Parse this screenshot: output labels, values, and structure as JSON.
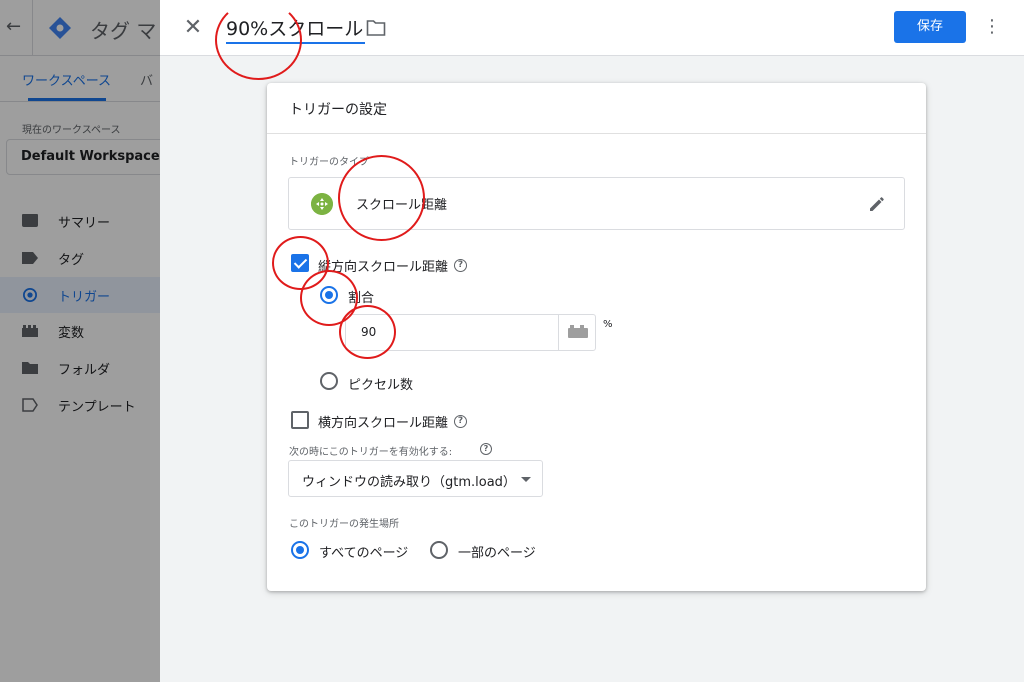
{
  "background": {
    "app_title": "タグ マ",
    "tabs": [
      "ワークスペース",
      "バ"
    ],
    "workspace_label": "現在のワークスペース",
    "workspace_name": "Default Workspace",
    "nav_items": [
      {
        "label": "サマリー",
        "icon": "summary-icon"
      },
      {
        "label": "タグ",
        "icon": "tag-icon"
      },
      {
        "label": "トリガー",
        "icon": "trigger-icon",
        "active": true
      },
      {
        "label": "変数",
        "icon": "variables-icon"
      },
      {
        "label": "フォルダ",
        "icon": "folder-icon"
      },
      {
        "label": "テンプレート",
        "icon": "template-icon"
      }
    ]
  },
  "header": {
    "title": "90%スクロール",
    "save_label": "保存"
  },
  "card": {
    "title": "トリガーの設定",
    "trigger_type_label": "トリガーのタイプ",
    "trigger_type_value": "スクロール距離",
    "vertical_label": "縦方向スクロール距離",
    "vertical_checked": true,
    "percent_label": "割合",
    "percent_value": "90",
    "percent_unit": "%",
    "pixels_label": "ピクセル数",
    "horizontal_label": "横方向スクロール距離",
    "horizontal_checked": false,
    "enable_label": "次の時にこのトリガーを有効化する:",
    "enable_value": "ウィンドウの読み取り（gtm.load）",
    "fire_on_label": "このトリガーの発生場所",
    "all_pages_label": "すべてのページ",
    "some_pages_label": "一部のページ"
  },
  "colors": {
    "accent": "#1a73e8",
    "annotation": "#e01b1b",
    "trigger_icon": "#7cb342"
  }
}
